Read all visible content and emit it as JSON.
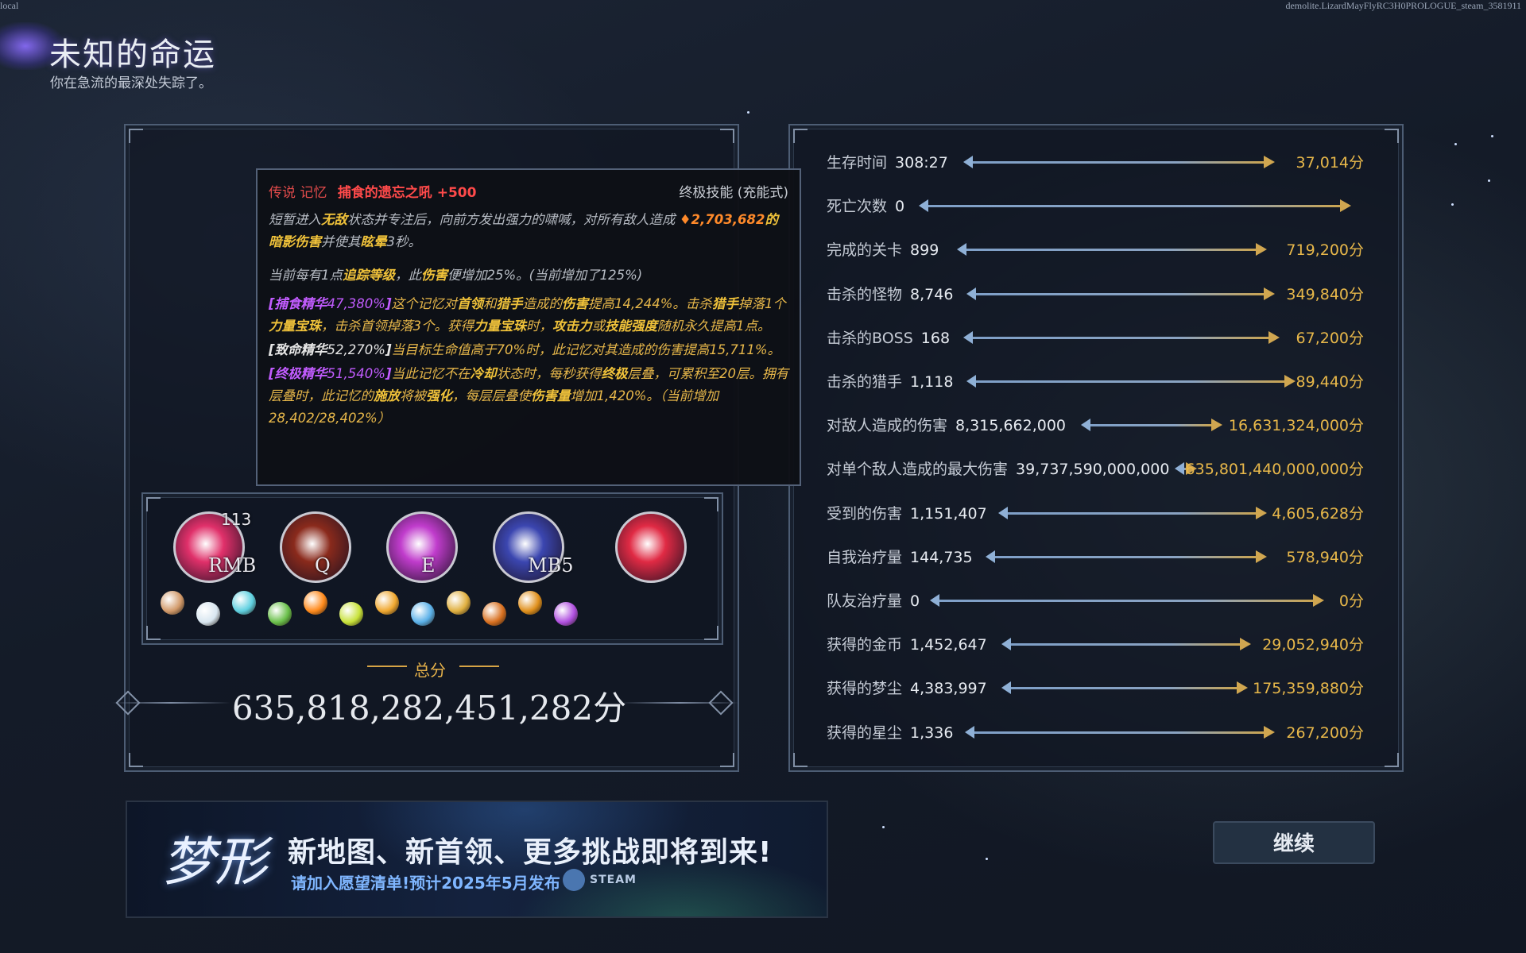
{
  "corner": {
    "left": "local",
    "right": "demolite.LizardMayFlyRC3H0PROLOGUE_steam_3581911"
  },
  "header": {
    "title": "未知的命运",
    "subtitle": "你在急流的最深处失踪了。"
  },
  "tooltip": {
    "rarity": "传说 记忆",
    "name": "捕食的遗忘之吼 +500",
    "type": "终极技能 (充能式)",
    "p1": {
      "a": "短暂进入",
      "b": "无敌",
      "c": "状态并专注后，向前方发出强力的啸喊，对所有敌人造成 ",
      "d": "♦2,703,682",
      "e": "的",
      "f": "暗影伤害",
      "g": "并使其",
      "h": "眩晕",
      "i": "3秒。"
    },
    "p2": {
      "a": "当前每有1点",
      "b": "追踪等级",
      "c": "，此",
      "d": "伤害",
      "e": "便增加25%。(当前增加了125%)"
    },
    "p3": {
      "a": "[捕食精华",
      "b": "47,380%",
      "c": "]",
      "d": "这个记忆对",
      "e": "首领",
      "f": "和",
      "g": "猎手",
      "h": "造成的",
      "i": "伤害",
      "j": "提高14,244%。击杀",
      "k": "猎手",
      "l": "掉落1个",
      "m": "力量宝珠",
      "n": "，击杀首领掉落3个。获得",
      "o": "力量宝珠",
      "p": "时，",
      "q": "攻击力",
      "r": "或",
      "s": "技能强度",
      "t": "随机永久提高1点。"
    },
    "p4": {
      "a": "[致命精华",
      "b": "52,270%",
      "c": "]",
      "d": "当目标生命值高于70%时，此记忆对其造成的伤害提高15,711%。"
    },
    "p5": {
      "a": "[终极精华",
      "b": "51,540%",
      "c": "]",
      "d": "当此记忆不在",
      "e": "冷却",
      "f": "状态时，每秒获得",
      "g": "终极",
      "h": "层叠，可累积至20层。拥有层叠时，此记忆的",
      "i": "施放",
      "j": "将被",
      "k": "强化",
      "l": "，每层层叠使",
      "m": "伤害量",
      "n": "增加1,420%。（当前增加28,402/28,402%）"
    }
  },
  "skills": [
    {
      "key": "RMB",
      "count": "113",
      "color": "#e0306a",
      "icon": "figure-burst-icon"
    },
    {
      "key": "Q",
      "count": "",
      "color": "#8a2a1c",
      "icon": "beast-maw-icon"
    },
    {
      "key": "E",
      "count": "",
      "color": "#c03ccc",
      "icon": "comet-icon"
    },
    {
      "key": "MB5",
      "count": "",
      "color": "#3b46b0",
      "icon": "roaring-wolf-icon"
    },
    {
      "key": "",
      "count": "",
      "color": "#e02a44",
      "icon": "spiral-vortex-icon"
    }
  ],
  "gems": [
    "#d29a6a",
    "#d8e6f0",
    "#5fd0e0",
    "#6ac04a",
    "#ff8a1c",
    "#c8e23a",
    "#f0a830",
    "#5ab0e8",
    "#e0b040",
    "#d87020",
    "#e0901c",
    "#b050e0"
  ],
  "total": {
    "label": "总分",
    "value": "635,818,282,451,282分"
  },
  "stats": [
    {
      "label": "生存时间",
      "value": "308:27",
      "score": "37,014分"
    },
    {
      "label": "死亡次数",
      "value": "0",
      "score": ""
    },
    {
      "label": "完成的关卡",
      "value": "899",
      "score": "719,200分"
    },
    {
      "label": "击杀的怪物",
      "value": "8,746",
      "score": "349,840分"
    },
    {
      "label": "击杀的BOSS",
      "value": "168",
      "score": "67,200分"
    },
    {
      "label": "击杀的猎手",
      "value": "1,118",
      "score": "89,440分"
    },
    {
      "label": "对敌人造成的伤害",
      "value": "8,315,662,000",
      "score": "16,631,324,000分"
    },
    {
      "label": "对单个敌人造成的最大伤害",
      "value": "39,737,590,000,000",
      "score": "635,801,440,000,000分"
    },
    {
      "label": "受到的伤害",
      "value": "1,151,407",
      "score": "4,605,628分"
    },
    {
      "label": "自我治疗量",
      "value": "144,735",
      "score": "578,940分"
    },
    {
      "label": "队友治疗量",
      "value": "0",
      "score": "0分"
    },
    {
      "label": "获得的金币",
      "value": "1,452,647",
      "score": "29,052,940分"
    },
    {
      "label": "获得的梦尘",
      "value": "4,383,997",
      "score": "175,359,880分"
    },
    {
      "label": "获得的星尘",
      "value": "1,336",
      "score": "267,200分"
    }
  ],
  "banner": {
    "logo": "梦形",
    "headline": "新地图、新首领、更多挑战即将到来!",
    "sub": "请加入愿望清单!预计2025年5月发布",
    "steam": "STEAM"
  },
  "continue_label": "继续"
}
